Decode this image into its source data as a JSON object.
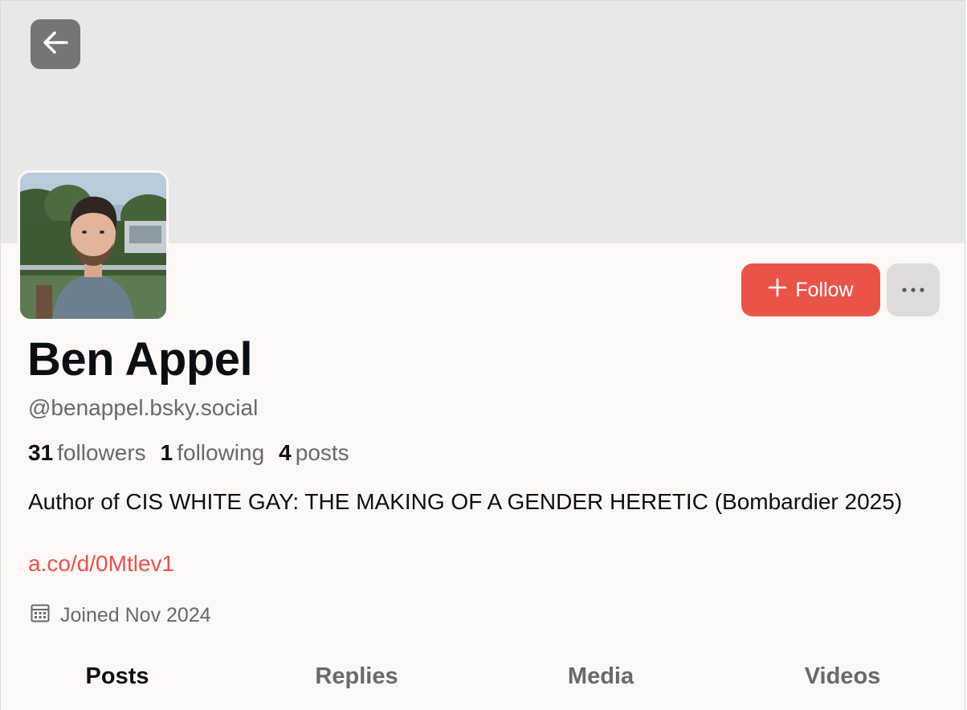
{
  "header": {
    "back_icon": "arrow-left-icon"
  },
  "profile": {
    "display_name": "Ben Appel",
    "handle": "@benappel.bsky.social",
    "avatar_icon": "profile-photo",
    "stats": {
      "followers_count": "31",
      "followers_label": "followers",
      "following_count": "1",
      "following_label": "following",
      "posts_count": "4",
      "posts_label": "posts"
    },
    "bio": "Author of CIS WHITE GAY: THE MAKING OF A GENDER HERETIC (Bombardier 2025)",
    "bio_link": "a.co/d/0Mtlev1",
    "joined": "Joined Nov 2024",
    "joined_icon": "calendar-icon"
  },
  "actions": {
    "follow_label": "Follow",
    "follow_icon": "plus-icon",
    "more_icon": "ellipsis-icon"
  },
  "tabs": [
    {
      "label": "Posts",
      "active": true
    },
    {
      "label": "Replies",
      "active": false
    },
    {
      "label": "Media",
      "active": false
    },
    {
      "label": "Videos",
      "active": false
    }
  ],
  "colors": {
    "accent": "#ea5448",
    "link": "#e5534b",
    "banner": "#e9e8e9",
    "background": "#fdf8f6",
    "muted_text": "#6b6866"
  }
}
